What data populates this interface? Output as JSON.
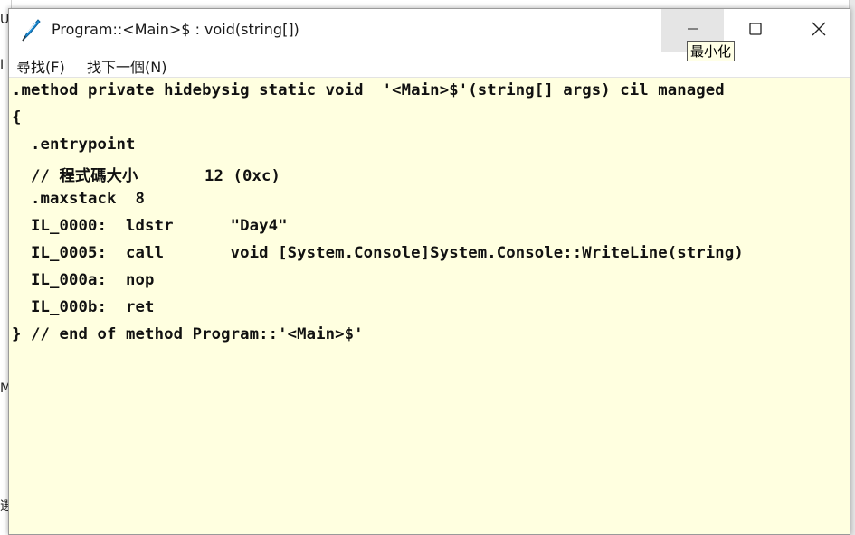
{
  "background": {
    "fragments": [
      "U",
      "I",
      "M",
      "選"
    ]
  },
  "window": {
    "title": "Program::<Main>$ : void(string[])",
    "icons": {
      "app": "quill-icon",
      "minimize": "minimize-icon",
      "maximize": "maximize-icon",
      "close": "close-icon"
    },
    "tooltip": "最小化"
  },
  "menu": {
    "items": [
      {
        "label": "尋找(F)"
      },
      {
        "label": "找下一個(N)"
      }
    ]
  },
  "code": {
    "lines": [
      ".method private hidebysig static void  '<Main>$'(string[] args) cil managed",
      "{",
      "  .entrypoint",
      "  // 程式碼大小       12 (0xc)",
      "  .maxstack  8",
      "  IL_0000:  ldstr      \"Day4\"",
      "  IL_0005:  call       void [System.Console]System.Console::WriteLine(string)",
      "  IL_000a:  nop",
      "  IL_000b:  ret",
      "} // end of method Program::'<Main>$'"
    ]
  },
  "colors": {
    "code_background": "#ffffe0",
    "titlebar": "#ffffff",
    "tooltip_background": "#ffffe6",
    "icon_accent": "#1e8fd8"
  }
}
